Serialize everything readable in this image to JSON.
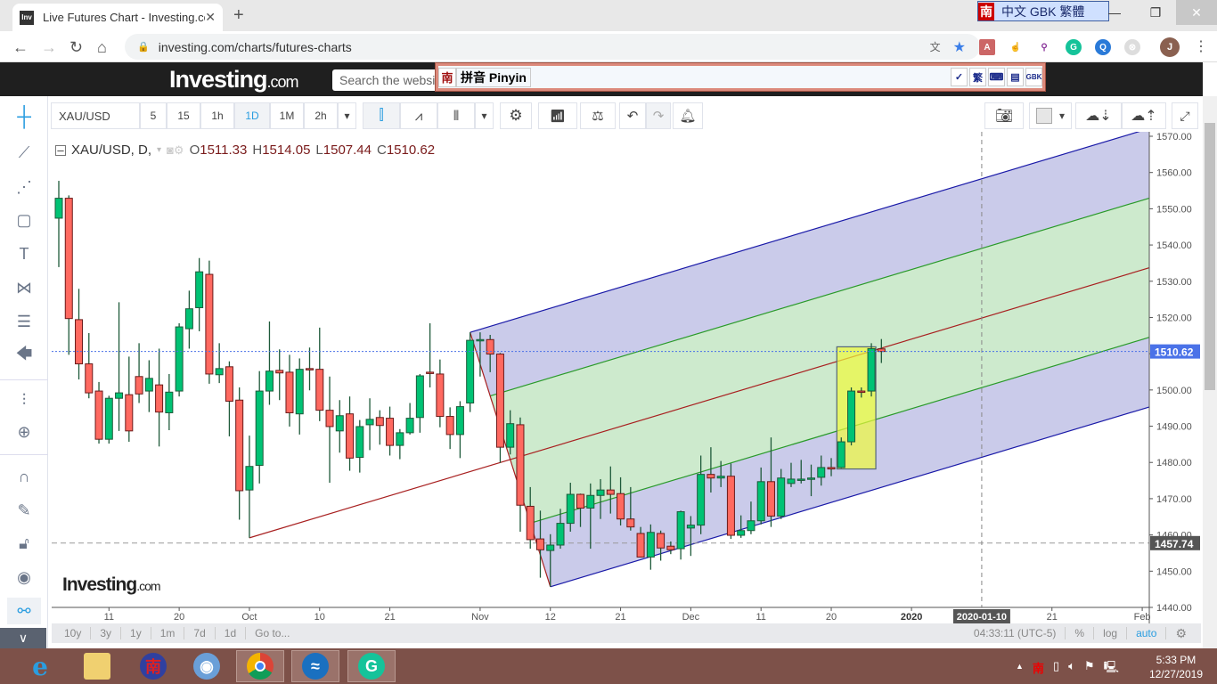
{
  "browser": {
    "tab_title": "Live Futures Chart - Investing.com",
    "favicon_text": "Inv",
    "url": "investing.com/charts/futures-charts",
    "profile_initial": "J"
  },
  "ime_top": {
    "logo": "南",
    "labels": "中文 GBK 繁體"
  },
  "site": {
    "logo": "Investing",
    "logo_suffix": ".com",
    "search_placeholder": "Search the website"
  },
  "ime_bar": {
    "logo": "南",
    "mode": "拼音 Pinyin",
    "buttons": [
      "✓",
      "繁",
      "⌨",
      "▤",
      "GBK"
    ]
  },
  "toolbar": {
    "symbol": "XAU/USD",
    "intervals": [
      "5",
      "15",
      "1h",
      "1D",
      "1M",
      "2h"
    ],
    "active_interval": "1D"
  },
  "legend": {
    "symbol": "XAU/USD, D,",
    "o_label": "O",
    "o": "1511.33",
    "h_label": "H",
    "h": "1514.05",
    "l_label": "L",
    "l": "1507.44",
    "c_label": "C",
    "c": "1510.62"
  },
  "watermark": {
    "text": "Investing",
    "suffix": ".com"
  },
  "bottom_bar": {
    "ranges": [
      "10y",
      "3y",
      "1y",
      "1m",
      "7d",
      "1d",
      "Go to..."
    ],
    "time": "04:33:11 (UTC-5)",
    "percent": "%",
    "log": "log",
    "auto": "auto"
  },
  "colors": {
    "up": "#00c274",
    "down": "#ff6960",
    "accent": "#2a9de0",
    "lastprice": "#4a72e8",
    "taskbar": "#7d5149"
  },
  "chart_data": {
    "type": "candlestick",
    "title": "XAU/USD, D",
    "ylim": [
      1440,
      1570
    ],
    "y_ticks": [
      "1440.00",
      "1450.00",
      "1460.00",
      "1470.00",
      "1480.00",
      "1490.00",
      "1500.00",
      "1510.00",
      "1520.00",
      "1530.00",
      "1540.00",
      "1550.00",
      "1560.00",
      "1570.00"
    ],
    "x_ticks": [
      {
        "label": "11",
        "index": 5
      },
      {
        "label": "20",
        "index": 12
      },
      {
        "label": "Oct",
        "index": 19
      },
      {
        "label": "10",
        "index": 26
      },
      {
        "label": "21",
        "index": 33
      },
      {
        "label": "Nov",
        "index": 42
      },
      {
        "label": "12",
        "index": 49
      },
      {
        "label": "21",
        "index": 56
      },
      {
        "label": "Dec",
        "index": 63
      },
      {
        "label": "11",
        "index": 70
      },
      {
        "label": "20",
        "index": 77
      },
      {
        "label": "2020",
        "index": 85
      },
      {
        "label": "21",
        "index": 99
      },
      {
        "label": "Feb",
        "index": 108
      }
    ],
    "crosshair": {
      "label": "2020-01-10",
      "index": 92
    },
    "x_max_index": 108.7,
    "last_price": {
      "label": "1510.62",
      "value": 1510.62
    },
    "horizontal_line": {
      "label": "1457.74",
      "value": 1457.74
    },
    "pitchfork": {
      "a": [
        19,
        1459.2
      ],
      "b": [
        41,
        1515.9
      ],
      "c": [
        49,
        1445.7
      ],
      "inner_levels": [
        0.25,
        0.75
      ]
    },
    "highlight_rect": {
      "from_index": 78,
      "to_index": 81,
      "top": 1511.9,
      "bottom": 1478.2
    },
    "ohlc": [
      [
        1547.4,
        1557.7,
        1533.9,
        1552.9
      ],
      [
        1552.9,
        1553.7,
        1509.7,
        1519.7
      ],
      [
        1519.4,
        1527.9,
        1502.9,
        1507.2
      ],
      [
        1507.2,
        1515.7,
        1497.7,
        1499.2
      ],
      [
        1499.7,
        1502.2,
        1485.2,
        1486.4
      ],
      [
        1486.4,
        1498.4,
        1485.2,
        1497.7
      ],
      [
        1497.7,
        1524.2,
        1488.7,
        1499.2
      ],
      [
        1498.7,
        1509.2,
        1485.7,
        1488.7
      ],
      [
        1503.7,
        1512.9,
        1496.4,
        1498.9
      ],
      [
        1499.7,
        1508.2,
        1493.9,
        1503.2
      ],
      [
        1501.4,
        1511.4,
        1484.4,
        1493.9
      ],
      [
        1493.7,
        1504.4,
        1488.9,
        1499.4
      ],
      [
        1499.7,
        1518.4,
        1498.2,
        1517.4
      ],
      [
        1516.9,
        1527.4,
        1511.4,
        1522.4
      ],
      [
        1522.7,
        1536.4,
        1516.2,
        1532.6
      ],
      [
        1531.9,
        1535.7,
        1501.7,
        1504.4
      ],
      [
        1504.2,
        1512.9,
        1501.9,
        1505.9
      ],
      [
        1506.4,
        1507.9,
        1487.2,
        1496.9
      ],
      [
        1497.2,
        1500.7,
        1464.2,
        1472.2
      ],
      [
        1472.4,
        1487.4,
        1459.2,
        1478.9
      ],
      [
        1479.2,
        1505.2,
        1474.2,
        1499.7
      ],
      [
        1499.7,
        1518.9,
        1495.9,
        1505.2
      ],
      [
        1505.4,
        1511.2,
        1497.2,
        1504.7
      ],
      [
        1504.9,
        1509.7,
        1489.9,
        1493.7
      ],
      [
        1493.4,
        1508.7,
        1487.7,
        1505.7
      ],
      [
        1505.9,
        1511.7,
        1499.9,
        1505.8
      ],
      [
        1505.7,
        1517.2,
        1491.4,
        1494.4
      ],
      [
        1494.4,
        1503.7,
        1474.4,
        1489.9
      ],
      [
        1488.7,
        1497.2,
        1482.7,
        1492.9
      ],
      [
        1493.4,
        1498.2,
        1477.7,
        1481.2
      ],
      [
        1481.4,
        1491.7,
        1477.2,
        1489.9
      ],
      [
        1490.4,
        1497.7,
        1483.4,
        1491.9
      ],
      [
        1492.4,
        1494.4,
        1484.9,
        1490.2
      ],
      [
        1492.2,
        1495.4,
        1481.9,
        1484.7
      ],
      [
        1484.7,
        1489.2,
        1480.9,
        1488.2
      ],
      [
        1488.2,
        1496.4,
        1487.7,
        1492.2
      ],
      [
        1492.4,
        1504.4,
        1488.2,
        1503.9
      ],
      [
        1504.9,
        1518.4,
        1500.7,
        1504.8
      ],
      [
        1504.4,
        1508.4,
        1489.7,
        1492.7
      ],
      [
        1492.7,
        1495.2,
        1483.7,
        1487.7
      ],
      [
        1487.7,
        1496.9,
        1481.2,
        1495.4
      ],
      [
        1496.4,
        1515.9,
        1493.9,
        1513.7
      ],
      [
        1513.7,
        1515.9,
        1503.7,
        1513.9
      ],
      [
        1513.9,
        1515.2,
        1504.9,
        1509.9
      ],
      [
        1509.9,
        1510.2,
        1479.9,
        1484.2
      ],
      [
        1484.2,
        1494.4,
        1482.2,
        1490.7
      ],
      [
        1490.4,
        1492.4,
        1460.9,
        1468.2
      ],
      [
        1467.9,
        1473.2,
        1456.2,
        1458.7
      ],
      [
        1458.9,
        1466.7,
        1448.2,
        1455.9
      ],
      [
        1455.7,
        1460.2,
        1445.7,
        1457.2
      ],
      [
        1457.2,
        1467.2,
        1456.2,
        1463.2
      ],
      [
        1463.2,
        1474.4,
        1460.9,
        1471.2
      ],
      [
        1471.2,
        1471.4,
        1462.2,
        1467.4
      ],
      [
        1467.4,
        1474.2,
        1456.2,
        1470.9
      ],
      [
        1470.9,
        1475.4,
        1464.4,
        1472.4
      ],
      [
        1472.4,
        1478.9,
        1465.9,
        1471.2
      ],
      [
        1471.4,
        1475.9,
        1462.6,
        1464.4
      ],
      [
        1464.4,
        1473.2,
        1461.2,
        1462.2
      ],
      [
        1460.4,
        1462.2,
        1453.9,
        1453.9
      ],
      [
        1453.9,
        1462.9,
        1450.4,
        1460.7
      ],
      [
        1460.4,
        1461.2,
        1452.9,
        1456.4
      ],
      [
        1456.9,
        1458.2,
        1454.7,
        1455.9
      ],
      [
        1456.2,
        1466.7,
        1453.2,
        1466.4
      ],
      [
        1461.9,
        1465.2,
        1454.2,
        1462.7
      ],
      [
        1462.7,
        1481.9,
        1460.2,
        1476.7
      ],
      [
        1476.7,
        1484.2,
        1471.7,
        1475.7
      ],
      [
        1475.7,
        1480.4,
        1473.2,
        1476.2
      ],
      [
        1476.2,
        1479.7,
        1458.9,
        1459.9
      ],
      [
        1459.9,
        1465.4,
        1459.2,
        1461.2
      ],
      [
        1461.2,
        1469.2,
        1460.2,
        1463.9
      ],
      [
        1463.9,
        1478.6,
        1462.9,
        1474.7
      ],
      [
        1474.7,
        1486.9,
        1462.2,
        1465.2
      ],
      [
        1465.2,
        1478.2,
        1464.4,
        1475.7
      ],
      [
        1474.2,
        1479.9,
        1473.2,
        1475.4
      ],
      [
        1475.2,
        1480.7,
        1474.2,
        1475.4
      ],
      [
        1475.4,
        1479.4,
        1470.7,
        1475.7
      ],
      [
        1475.9,
        1481.9,
        1473.6,
        1478.6
      ],
      [
        1478.6,
        1481.2,
        1476.2,
        1478.2
      ],
      [
        1478.6,
        1486.9,
        1478.4,
        1485.7
      ],
      [
        1485.7,
        1500.7,
        1484.7,
        1499.7
      ],
      [
        1499.7,
        1500.7,
        1497.9,
        1499.5
      ],
      [
        1499.7,
        1512.9,
        1498.2,
        1511.4
      ],
      [
        1511.33,
        1514.05,
        1507.44,
        1510.62
      ]
    ]
  },
  "taskbar": {
    "apps": [
      "internet-explorer",
      "file-explorer",
      "nanjing-ime",
      "chromium",
      "chrome",
      "openoffice",
      "grammarly"
    ],
    "time": "5:33 PM",
    "date": "12/27/2019"
  }
}
